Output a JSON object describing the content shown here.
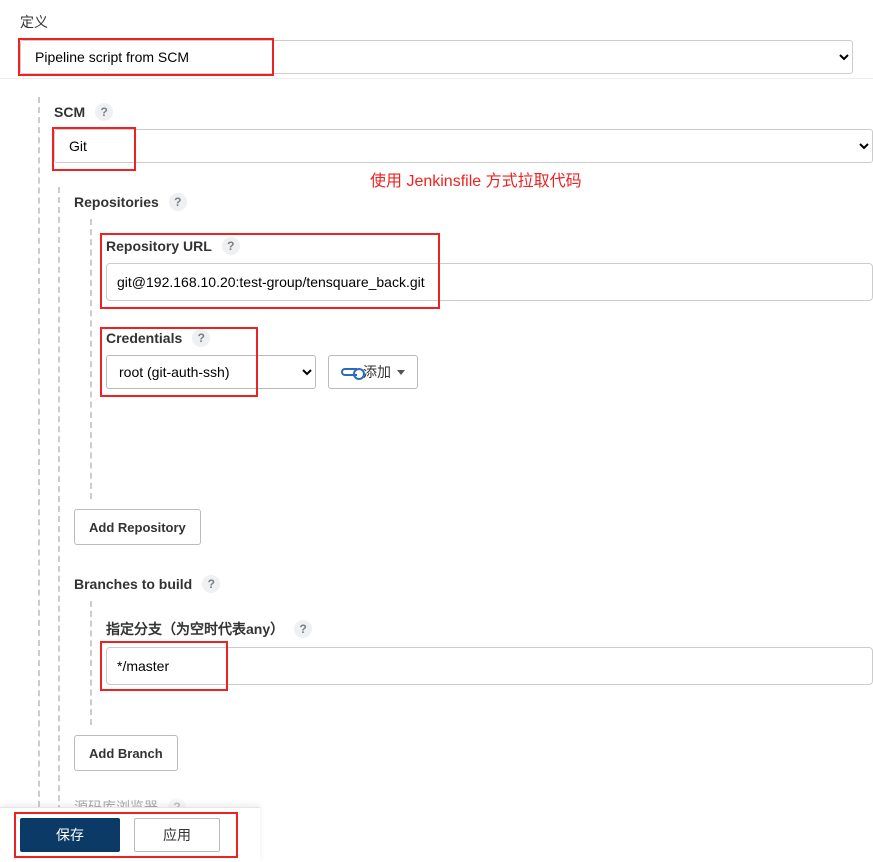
{
  "annotation": "使用 Jenkinsfile 方式拉取代码",
  "definition": {
    "label": "定义",
    "value": "Pipeline script from SCM"
  },
  "scm": {
    "label": "SCM",
    "value": "Git"
  },
  "repositories": {
    "label": "Repositories",
    "url_label": "Repository URL",
    "url_value": "git@192.168.10.20:test-group/tensquare_back.git",
    "credentials_label": "Credentials",
    "credentials_value": "root (git-auth-ssh)",
    "add_button": "添加",
    "add_repo_button": "Add Repository"
  },
  "branches": {
    "label": "Branches to build",
    "spec_label": "指定分支（为空时代表any）",
    "spec_value": "*/master",
    "add_branch_button": "Add Branch"
  },
  "browser": {
    "label": "源码库浏览器"
  },
  "footer": {
    "save": "保存",
    "apply": "应用"
  },
  "help_glyph": "?"
}
